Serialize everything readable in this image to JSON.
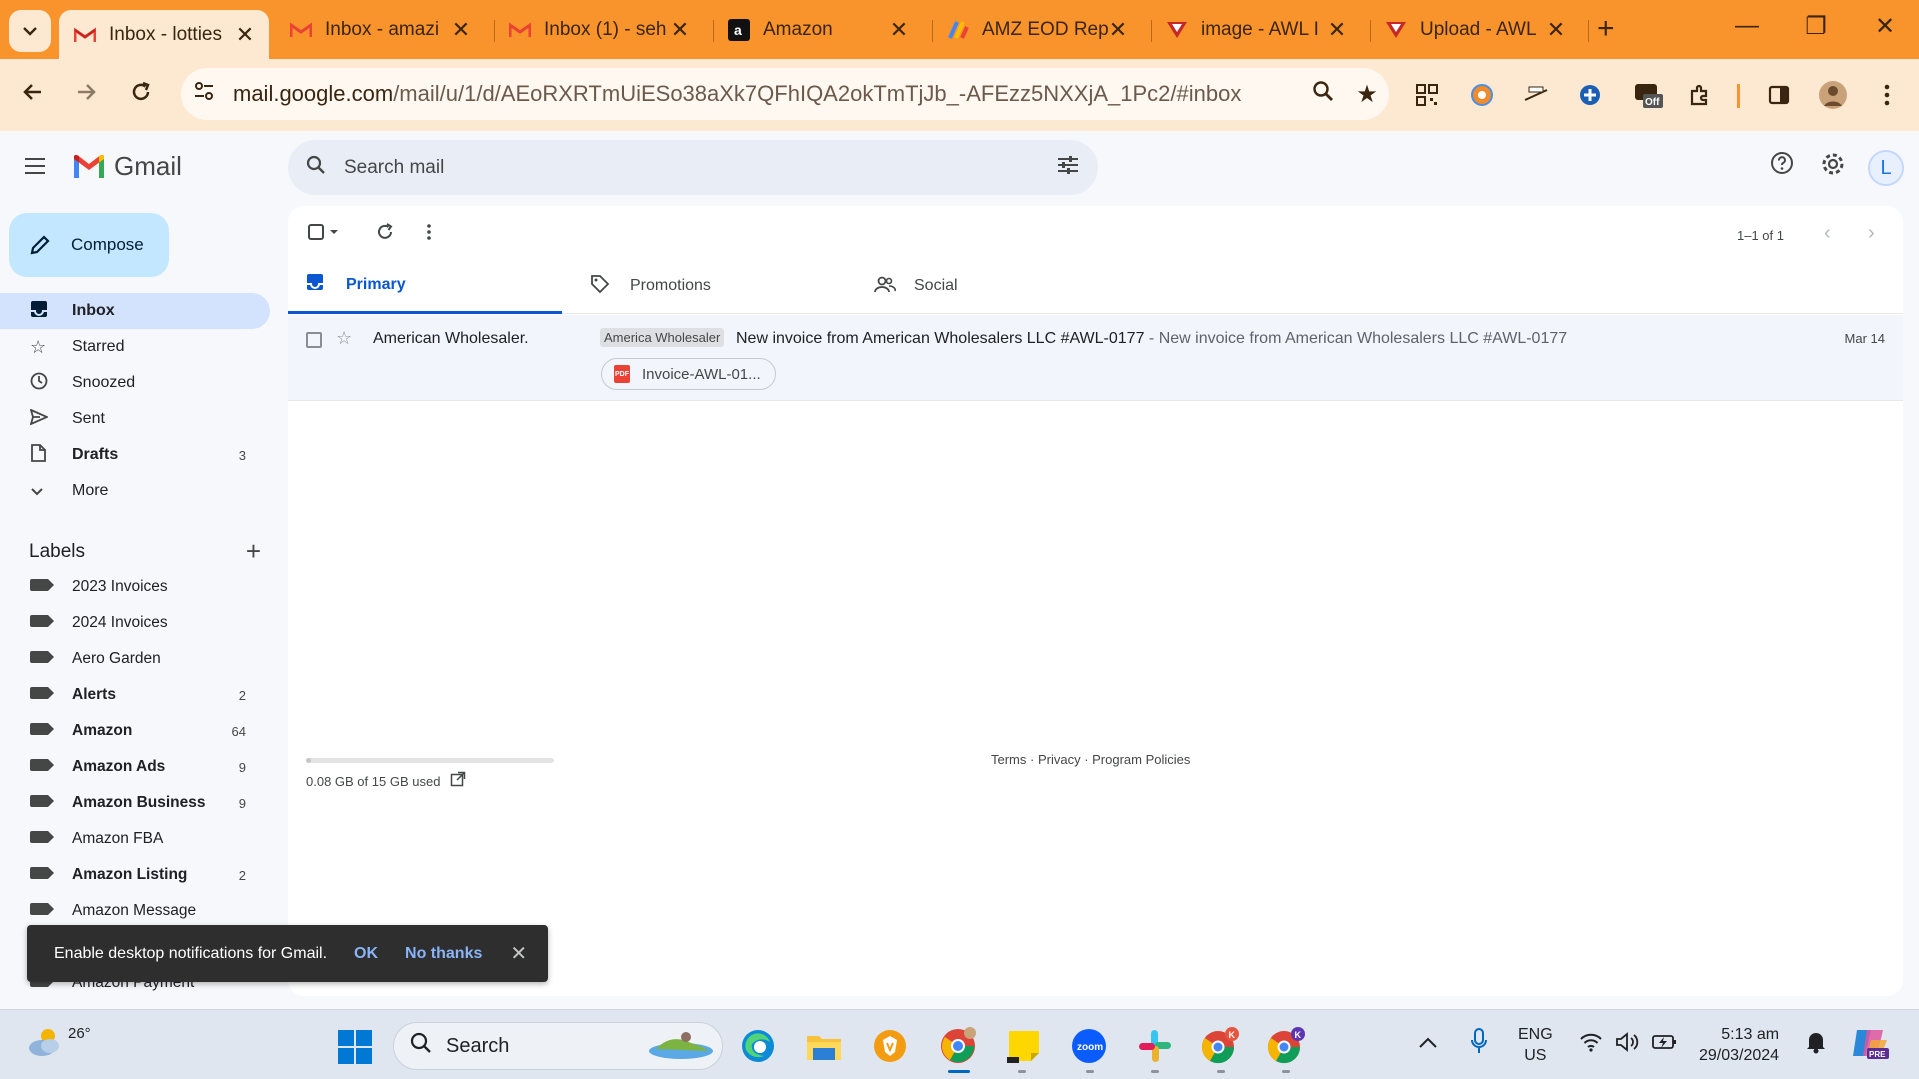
{
  "browser": {
    "tabs": [
      {
        "title": "Inbox - lotties",
        "active": true
      },
      {
        "title": "Inbox - amazi",
        "active": false
      },
      {
        "title": "Inbox (1) - seh",
        "active": false
      },
      {
        "title": "Amazon",
        "active": false
      },
      {
        "title": "AMZ EOD Rep",
        "active": false
      },
      {
        "title": "image - AWL I",
        "active": false
      },
      {
        "title": "Upload - AWL",
        "active": false
      }
    ],
    "url_host": "mail.google.com",
    "url_path": "/mail/u/1/d/AEoRXRTmUiESo38aXk7QFhIQA2okTmTjJb_-AFEzz5NXXjA_1Pc2/#inbox",
    "ext_off_badge": "Off",
    "accent": "#f9932b"
  },
  "gmail": {
    "logo_text": "Gmail",
    "search_placeholder": "Search mail",
    "avatar_letter": "L",
    "compose_label": "Compose",
    "nav": [
      {
        "label": "Inbox",
        "icon": "inbox-icon",
        "count": "",
        "active": true
      },
      {
        "label": "Starred",
        "icon": "star-icon",
        "count": "",
        "active": false
      },
      {
        "label": "Snoozed",
        "icon": "clock-icon",
        "count": "",
        "active": false
      },
      {
        "label": "Sent",
        "icon": "send-icon",
        "count": "",
        "active": false
      },
      {
        "label": "Drafts",
        "icon": "draft-icon",
        "count": "3",
        "active": false,
        "bold": true
      },
      {
        "label": "More",
        "icon": "chevron-down-icon",
        "count": "",
        "active": false
      }
    ],
    "labels_heading": "Labels",
    "labels": [
      {
        "label": "2023 Invoices",
        "count": "",
        "bold": false
      },
      {
        "label": "2024 Invoices",
        "count": "",
        "bold": false
      },
      {
        "label": "Aero Garden",
        "count": "",
        "bold": false
      },
      {
        "label": "Alerts",
        "count": "2",
        "bold": true
      },
      {
        "label": "Amazon",
        "count": "64",
        "bold": true
      },
      {
        "label": "Amazon Ads",
        "count": "9",
        "bold": true
      },
      {
        "label": "Amazon Business",
        "count": "9",
        "bold": true
      },
      {
        "label": "Amazon FBA",
        "count": "",
        "bold": false
      },
      {
        "label": "Amazon Listing",
        "count": "2",
        "bold": true
      },
      {
        "label": "Amazon Message",
        "count": "",
        "bold": false
      },
      {
        "label": "",
        "count": "",
        "bold": false
      },
      {
        "label": "Amazon Payment",
        "count": "",
        "bold": false
      }
    ],
    "page_info": "1–1 of 1",
    "tabs": [
      {
        "label": "Primary",
        "icon": "inbox-icon",
        "active": true
      },
      {
        "label": "Promotions",
        "icon": "tag-icon",
        "active": false
      },
      {
        "label": "Social",
        "icon": "people-icon",
        "active": false
      }
    ],
    "email": {
      "sender": "American Wholesaler.",
      "tag": "America Wholesaler",
      "subject": "New invoice from American Wholesalers LLC #AWL-0177",
      "snippet": " - New invoice from American Wholesalers LLC #AWL-0177",
      "date": "Mar 14",
      "attachment": "Invoice-AWL-01...",
      "attachment_type": "PDF"
    },
    "storage_text": "0.08 GB of 15 GB used",
    "storage_fraction": 0.0053,
    "footer_terms": "Terms",
    "footer_privacy": "Privacy",
    "footer_policies": "Program Policies",
    "toast": {
      "message": "Enable desktop notifications for Gmail.",
      "ok": "OK",
      "no_thanks": "No thanks"
    }
  },
  "taskbar": {
    "temperature": "26°",
    "search_label": "Search",
    "lang_line1": "ENG",
    "lang_line2": "US",
    "time": "5:13 am",
    "date": "29/03/2024",
    "zoom_label": "zoom",
    "chrome_badge_1": "K",
    "chrome_badge_2": "K",
    "copilot_badge": "PRE"
  }
}
